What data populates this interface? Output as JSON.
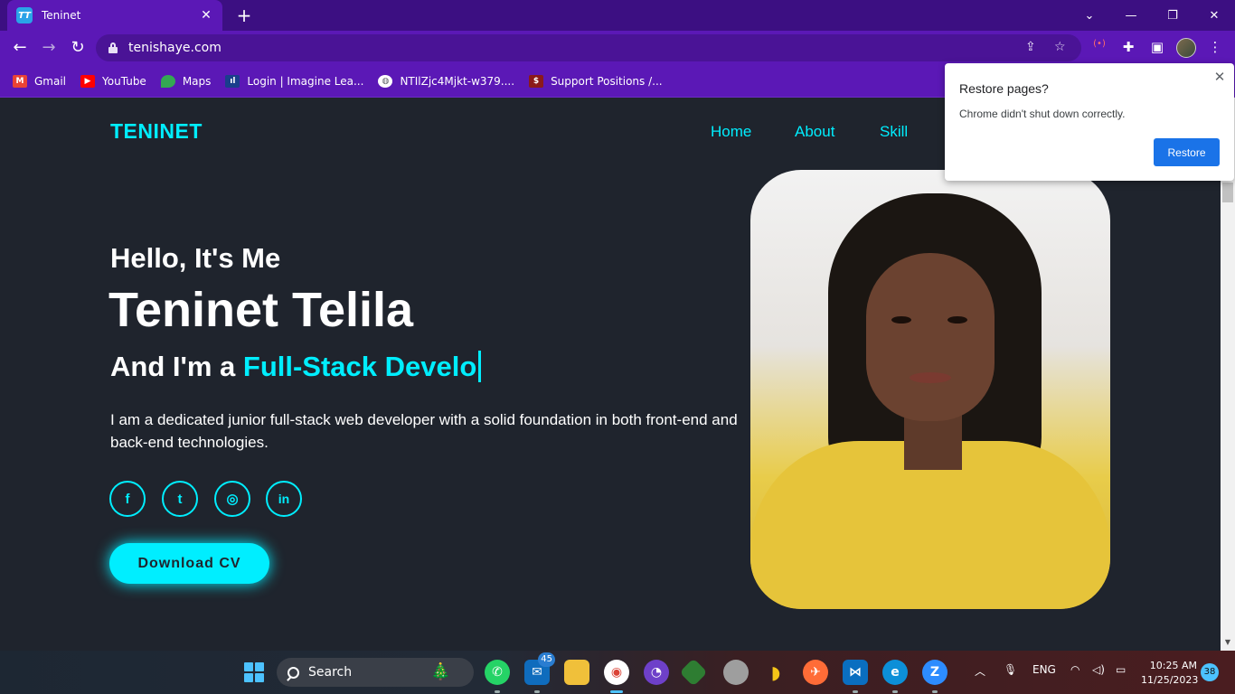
{
  "browser": {
    "tab_title": "Teninet",
    "tab_favicon": "TT",
    "url": "tenishaye.com",
    "bookmarks": [
      {
        "label": "Gmail",
        "icon": "gmail-icon",
        "color": "#ea4335"
      },
      {
        "label": "YouTube",
        "icon": "youtube-icon",
        "color": "#ff0000"
      },
      {
        "label": "Maps",
        "icon": "maps-icon",
        "color": "#34a853"
      },
      {
        "label": "Login | Imagine Lea...",
        "icon": "imagine-learning-icon",
        "color": "#1a3e8c"
      },
      {
        "label": "NTIlZjc4Mjkt-w379....",
        "icon": "globe-icon",
        "color": "#5f6368"
      },
      {
        "label": "Support Positions /...",
        "icon": "dollar-icon",
        "color": "#8b1a1a"
      }
    ]
  },
  "popup": {
    "title": "Restore pages?",
    "message": "Chrome didn't shut down correctly.",
    "button": "Restore"
  },
  "site": {
    "logo": "TENINET",
    "nav": [
      "Home",
      "About",
      "Skill"
    ],
    "hello": "Hello, It's Me",
    "name": "Teninet Telila",
    "role_prefix": "And I'm a ",
    "role_typed": "Full-Stack Develo",
    "bio": "I am a dedicated junior full-stack web developer with a solid foundation in both front-end and back-end technologies.",
    "social": [
      {
        "icon": "facebook-icon",
        "glyph": "f"
      },
      {
        "icon": "twitter-icon",
        "glyph": "t"
      },
      {
        "icon": "instagram-icon",
        "glyph": "◎"
      },
      {
        "icon": "linkedin-icon",
        "glyph": "in"
      }
    ],
    "cv_button": "Download CV",
    "accent_color": "#00eeff",
    "background_color": "#1f242d"
  },
  "taskbar": {
    "search_label": "Search",
    "mail_badge": "45",
    "language": "ENG",
    "time": "10:25 AM",
    "date": "11/25/2023",
    "notifications": "38"
  }
}
